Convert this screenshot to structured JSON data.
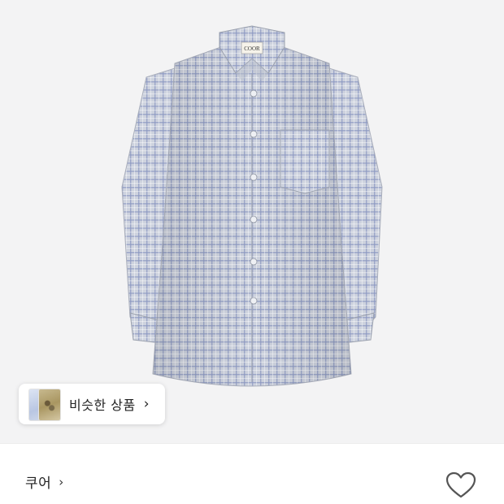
{
  "product": {
    "image_alt": "Blue check long-sleeve shirt",
    "tag_text": "COOR"
  },
  "similar": {
    "label": "비슷한 상품",
    "chevron": "›"
  },
  "brand": {
    "name": "쿠어",
    "chevron": "›"
  },
  "icons": {
    "like": "heart-outline-icon",
    "chevron": "chevron-right-icon"
  },
  "colors": {
    "shirt_base": "#c9cfdc",
    "check_line": "#8e9bc4",
    "outline": "#555555"
  }
}
